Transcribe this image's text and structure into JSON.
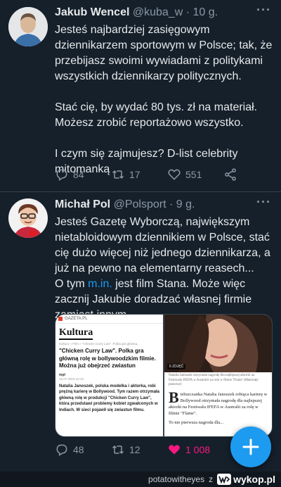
{
  "tweet1": {
    "name": "Jakub Wencel",
    "meta": "@kuba_w · 10 g.",
    "text": "Jesteś najbardziej zasięgowym dziennikarzem sportowym w Polsce; tak, że przebijasz swoimi wywiadami z politykami wszystkich dziennikarzy politycznych.\n\nStać cię, by wydać 80 tys. zł na materiał. Możesz zrobić reportażowo wszystko.\n\nI czym się zajmujesz? D-list celebrity mitomanką",
    "replies": "84",
    "retweets": "17",
    "likes": "551"
  },
  "tweet2": {
    "name": "Michał Pol",
    "meta": "@Polsport · 9 g.",
    "text_part1": "Jesteś Gazetę Wyborczą, największym nietabloidowym dziennikiem w Polsce, stać cię dużo więcej niż jednego dziennikarza, a już na pewno na elementarny reasech...\nO tym ",
    "link": "m.in.",
    "text_part2": " jest film Stana. Może więc zacznij Jakubie doradzać własnej firmie zamiast innym",
    "replies": "48",
    "retweets": "12",
    "likes": "1 008",
    "like_color": "#f91880",
    "media": {
      "left": {
        "site": "GAZETA.PL",
        "section": "Kultura",
        "crumb": "Kultura » Film » \"Chicken Curry Law\". Polka gra główną...",
        "headline": "\"Chicken Curry Law\". Polka gra główną rolę w bollywoodzkim filmie. Można już obejrzeć zwiastun",
        "author": "mpl",
        "date": "15.07.2019 10:15",
        "lead": "Natalia Janoszek, polska modelka i aktorka, robi prężną karierę w Bollywood. Tym razem otrzymała główną rolę w produkcji \"Chicken Curry Law\", która przedstawi problemy kobiet zgwałconych w Indiach. W sieci pojawił się zwiastun filmu."
      },
      "right": {
        "photo_label": "6 ZDJĘĆ",
        "caption": "Natalia Janoszek otrzymała nagrodę dla najlepszej aktorki na Festiwalu IFEFA w Australii za rolę w filmie 'Flame' (Materiały prasowe)",
        "dropcap": "B",
        "article": "iebszczanka Natalia Janoszek robiąca karierę w Bollywood otrzymała nagrodę dla najlepszej aktorki na Festiwalu IFEFA w Australii za rolę w filmie \"Flame\".",
        "more": "To nie pierwsza nagroda dla..."
      }
    }
  },
  "footer": {
    "user": "potatowitheyes",
    "sep": "z",
    "brand": "wykop.pl"
  },
  "colors": {
    "background": "#15202b",
    "accent": "#1d9bf0",
    "muted": "#8b98a5"
  }
}
